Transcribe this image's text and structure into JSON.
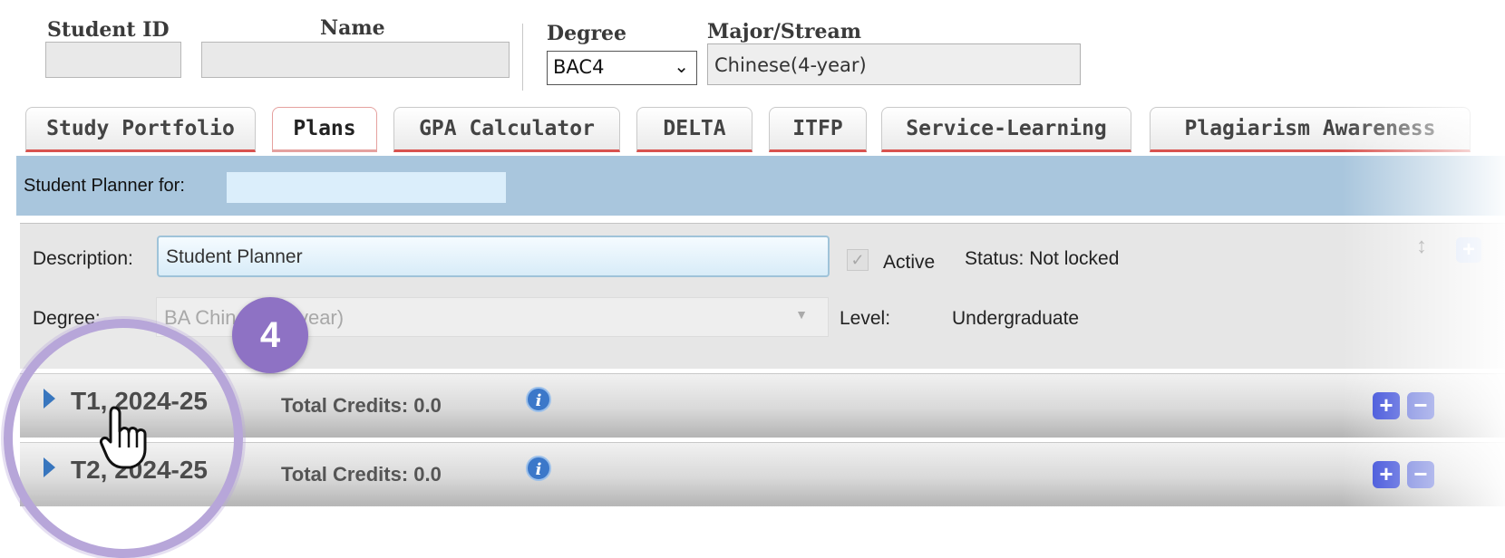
{
  "header": {
    "student_id_label": "Student ID",
    "name_label": "Name",
    "degree_label": "Degree",
    "degree_value": "BAC4",
    "major_label": "Major/Stream",
    "major_value": "Chinese(4-year)"
  },
  "tabs": [
    {
      "label": "Study Portfolio"
    },
    {
      "label": "Plans"
    },
    {
      "label": "GPA Calculator"
    },
    {
      "label": "DELTA"
    },
    {
      "label": "ITFP"
    },
    {
      "label": "Service-Learning"
    },
    {
      "label": "Plagiarism Awareness"
    }
  ],
  "planner": {
    "label": "Student Planner for:",
    "description_label": "Description:",
    "description_value": "Student Planner",
    "active_label": "Active",
    "status_text": "Status: Not locked",
    "degree_label": "Degree:",
    "degree_value": "BA Chinese (4-year)",
    "level_label": "Level:",
    "level_value": "Undergraduate"
  },
  "terms": [
    {
      "title": "T1, 2024-25",
      "credits": "Total Credits: 0.0"
    },
    {
      "title": "T2, 2024-25",
      "credits": "Total Credits: 0.0"
    }
  ],
  "icons": {
    "info": "info-icon",
    "plus": "plus-icon",
    "minus": "minus-icon",
    "expand": "expand-icon",
    "caret": "caret-right-icon",
    "checkbox": "checkbox-checked-icon",
    "cursor": "hand-pointer-icon"
  },
  "annotation": {
    "step_number": "4"
  },
  "colors": {
    "accent_blue": "#2c3fd6",
    "tab_underline": "#d9534f",
    "planner_strip": "#a9c6dd",
    "highlight_ring": "#b7a6d9",
    "badge": "#8e72c4"
  }
}
